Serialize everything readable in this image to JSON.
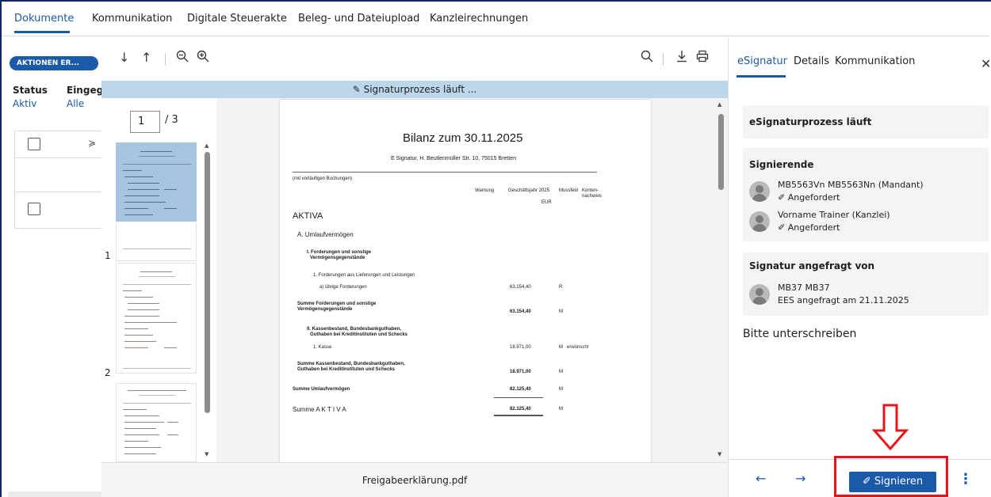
{
  "topnav": {
    "tabs": [
      "Dokumente",
      "Kommunikation",
      "Digitale Steuerakte",
      "Beleg- und Dateiupload",
      "Kanzleirechnungen"
    ]
  },
  "background": {
    "actions_label": "AKTIONEN ER...",
    "status_header": "Status",
    "status_value": "Aktiv",
    "eingang_header": "Eingega",
    "eingang_value": "Alle"
  },
  "viewer": {
    "banner": "Signaturprozess läuft ...",
    "page_current": "1",
    "page_total": "/ 3",
    "thumb_numbers": [
      "1",
      "2"
    ],
    "filename": "Freigabeerklärung.pdf"
  },
  "document": {
    "title": "Bilanz zum 30.11.2025",
    "subtitle": "E Signatur, H. Beutlenmüller Str. 10, 75015 Bretten",
    "note": "(mit vorläufigen Buchungen)",
    "col_warnung": "Warnung",
    "col_geschaeftsjahr": "Geschäftsjahr 2025",
    "col_mussfeld": "Mussfeld",
    "col_konten": "Konten-",
    "col_nachweis": "nachweis",
    "col_eur": "EUR",
    "aktiva": "AKTIVA",
    "umlauf": "A. Umlaufvermögen",
    "forderungen_1": "I. Forderungen und sonstige",
    "forderungen_2": "Vermögensgegenstände",
    "lieferungen": "1. Forderungen aus Lieferungen und Leistungen",
    "uebrige": "a) übrige Forderungen",
    "uebrige_val": "63.154,40",
    "uebrige_flag": "R",
    "summe_ford_1": "Summe Forderungen und sonstige",
    "summe_ford_2": "Vermögensgegenstände",
    "summe_ford_val": "63.154,40",
    "summe_ford_flag": "M",
    "kassen_1": "II. Kassenbestand, Bundesbankguthaben,",
    "kassen_2": "Guthaben bei Kreditinstituten und Schecks",
    "kasse": "1. Kasse",
    "kasse_val": "18.971,00",
    "kasse_flag": "M",
    "kasse_note": "erwünscht",
    "summe_kassen_1": "Summe Kassenbestand, Bundesbankguthaben,",
    "summe_kassen_2": "Guthaben bei Kreditinstituten und Schecks",
    "summe_kassen_val": "18.971,00",
    "summe_kassen_flag": "M",
    "summe_umlauf": "Summe Umlaufvermögen",
    "summe_umlauf_val": "82.125,40",
    "summe_umlauf_flag": "M",
    "summe_aktiva": "Summe A K T I V A",
    "summe_aktiva_val": "82.125,40",
    "summe_aktiva_flag": "M"
  },
  "panel": {
    "tabs": [
      "eSignatur",
      "Details",
      "Kommunikation"
    ],
    "process_title": "eSignaturprozess läuft",
    "signers_title": "Signierende",
    "signers": [
      {
        "name": "MB5563Vn MB5563Nn (Mandant)",
        "status": "Angefordert"
      },
      {
        "name": "Vorname Trainer (Kanzlei)",
        "status": "Angefordert"
      }
    ],
    "requested_title": "Signatur angefragt von",
    "requester_name": "MB37 MB37",
    "requester_info": "EES angefragt am 21.11.2025",
    "please_sign": "Bitte unterschreiben",
    "sign_label": "Signieren"
  },
  "colors": {
    "accent": "#1b5aa8",
    "banner": "#bcd6ec",
    "highlight": "#e8141b"
  }
}
